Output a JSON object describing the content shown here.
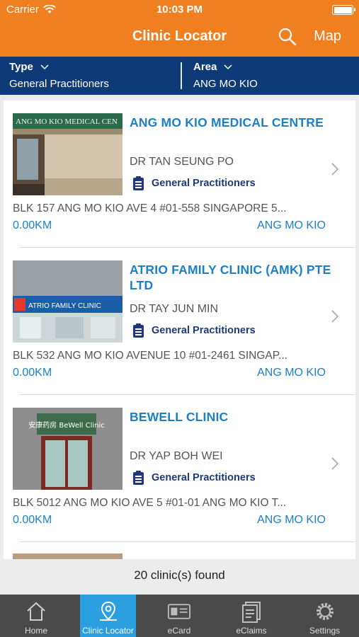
{
  "status_bar": {
    "carrier": "Carrier",
    "time": "10:03 PM"
  },
  "nav": {
    "title": "Clinic Locator",
    "map_label": "Map"
  },
  "filters": {
    "type": {
      "label": "Type",
      "value": "General Practitioners"
    },
    "area": {
      "label": "Area",
      "value": "ANG MO KIO"
    }
  },
  "clinics": [
    {
      "name": "ANG MO KIO MEDICAL CENTRE",
      "doctor": "DR TAN SEUNG PO",
      "specialty": "General Practitioners",
      "address": "BLK 157 ANG MO KIO AVE 4  #01-558   SINGAPORE 5...",
      "distance": "0.00KM",
      "area": "ANG MO KIO",
      "sign_text": "ANG MO KIO MEDICAL CEN"
    },
    {
      "name": "ATRIO FAMILY CLINIC (AMK) PTE LTD",
      "doctor": "DR TAY JUN MIN",
      "specialty": "General Practitioners",
      "address": "BLK 532 ANG MO KIO AVENUE 10  #01-2461  SINGAP...",
      "distance": "0.00KM",
      "area": "ANG MO KIO",
      "sign_text": "ATRIO FAMILY CLINIC"
    },
    {
      "name": "BEWELL CLINIC",
      "doctor": "DR YAP BOH WEI",
      "specialty": "General Practitioners",
      "address": "BLK 5012 ANG MO KIO AVE 5  #01-01 ANG MO KIO T...",
      "distance": "0.00KM",
      "area": "ANG MO KIO",
      "sign_text": "安康药房 BeWell Clinic"
    }
  ],
  "result_count": "20 clinic(s) found",
  "tabs": [
    {
      "label": "Home",
      "icon": "home-icon",
      "active": false
    },
    {
      "label": "Clinic Locator",
      "icon": "map-pin-icon",
      "active": true
    },
    {
      "label": "eCard",
      "icon": "card-icon",
      "active": false
    },
    {
      "label": "eClaims",
      "icon": "claims-icon",
      "active": false
    },
    {
      "label": "Settings",
      "icon": "gear-icon",
      "active": false
    }
  ],
  "colors": {
    "header": "#f07f1f",
    "filter_bar": "#0f3a78",
    "link": "#1d7fc4",
    "tab_active": "#2c9fe0",
    "tab_bar": "#4a4a4a"
  }
}
